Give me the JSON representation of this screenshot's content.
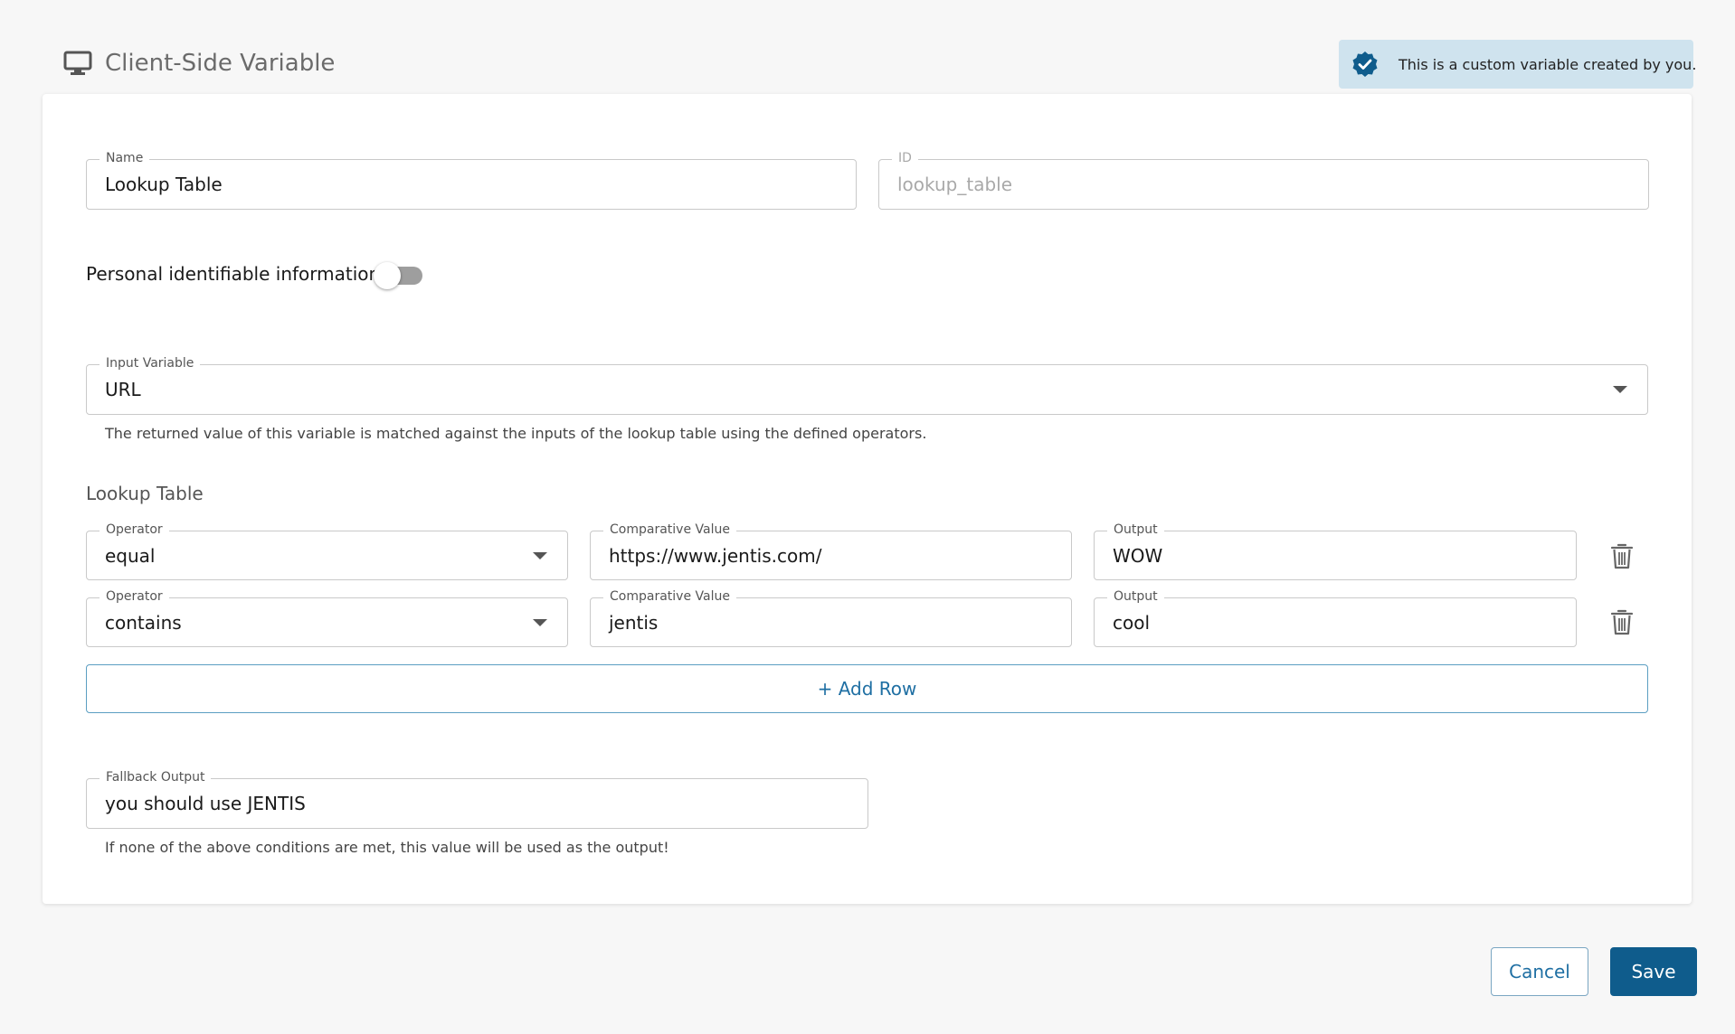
{
  "header": {
    "title": "Client-Side Variable",
    "icon": "monitor-icon"
  },
  "badge": {
    "text": "This is a custom variable created by you.",
    "icon": "verified-check-icon",
    "color": "#0f5c8c"
  },
  "form": {
    "name": {
      "label": "Name",
      "value": "Lookup Table"
    },
    "id": {
      "label": "ID",
      "value": "lookup_table"
    },
    "pii": {
      "label": "Personal identifiable information",
      "enabled": false
    },
    "input_variable": {
      "label": "Input Variable",
      "value": "URL",
      "helper": "The returned value of this variable is matched against the inputs of the lookup table using the defined operators."
    },
    "lookup_table": {
      "title": "Lookup Table",
      "rows": [
        {
          "operator_label": "Operator",
          "operator": "equal",
          "comparative_label": "Comparative Value",
          "comparative": "https://www.jentis.com/",
          "output_label": "Output",
          "output": "WOW"
        },
        {
          "operator_label": "Operator",
          "operator": "contains",
          "comparative_label": "Comparative Value",
          "comparative": "jentis",
          "output_label": "Output",
          "output": "cool"
        }
      ],
      "add_row_label": "+ Add Row"
    },
    "fallback": {
      "label": "Fallback Output",
      "value": "you should use JENTIS",
      "helper": "If none of the above conditions are met, this value will be used as the output!"
    }
  },
  "actions": {
    "cancel_label": "Cancel",
    "save_label": "Save",
    "primary_color": "#0f5c8c"
  }
}
